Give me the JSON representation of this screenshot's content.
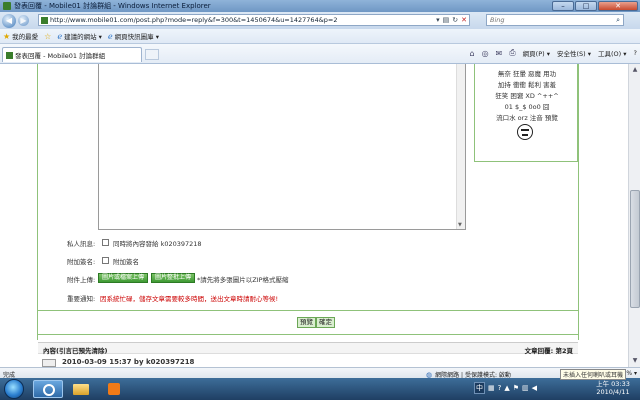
{
  "window": {
    "title": "發表回覆 - Mobile01 討論群組 - Windows Internet Explorer",
    "min": "–",
    "max": "□",
    "close": "✕"
  },
  "address": {
    "url": "http://www.mobile01.com/post.php?mode=reply&f=300&t=1450674&u=1427764&p=2",
    "search_placeholder": "Bing"
  },
  "favorites": {
    "label": "我的最愛",
    "items": [
      "建議的網站 ▾",
      "網頁快訊圖庫 ▾"
    ]
  },
  "tab": {
    "label": "發表回覆 - Mobile01 討論群組"
  },
  "commands": {
    "page": "網頁(P) ▾",
    "safety": "安全性(S) ▾",
    "tools": "工具(O) ▾",
    "help": "?"
  },
  "smileys": {
    "rows": [
      "無奈  狂暈  惡魔  用功",
      "加持  衝衝  鬆利  害羞",
      "狂笑  困窘  XD  ^++^",
      "01  $_$  0o0  囧",
      "流口水  orz  注音  預覽"
    ]
  },
  "form": {
    "private_label": "私人訊息:",
    "private_text": "同時將內容發給 k020397218",
    "signature_label": "附加簽名:",
    "signature_text": "附加簽名",
    "upload_label": "附件上傳:",
    "upload_btn1": "圖片或檔案上傳",
    "upload_btn2": "圖片整批上傳",
    "upload_hint": "*請先將多張圖片以ZIP格式壓縮",
    "notice_label": "重要通知:",
    "notice_text": "因系統忙碌，儲存文章需要較多時間，送出文章時請耐心等候!",
    "preview_btn": "預覽",
    "submit_btn": "確定"
  },
  "quote_section": {
    "title": "內容(引言已預先清除)",
    "reply_count": "文章回覆: 第2頁",
    "post_meta": "2010-03-09 15:37 by k020397218"
  },
  "status": {
    "left": "完成",
    "network": "網際網路 | 受保護模式: 啟動",
    "zoom": "100% ▾"
  },
  "taskbar": {
    "ime": "中",
    "tooltip": "未插入任何喇叭或耳機",
    "time": "上午 03:33",
    "date": "2010/4/11"
  },
  "colors": {
    "border_green": "#8fc27a",
    "notice_red": "#cc0000",
    "button_green": "#3e9a33"
  }
}
